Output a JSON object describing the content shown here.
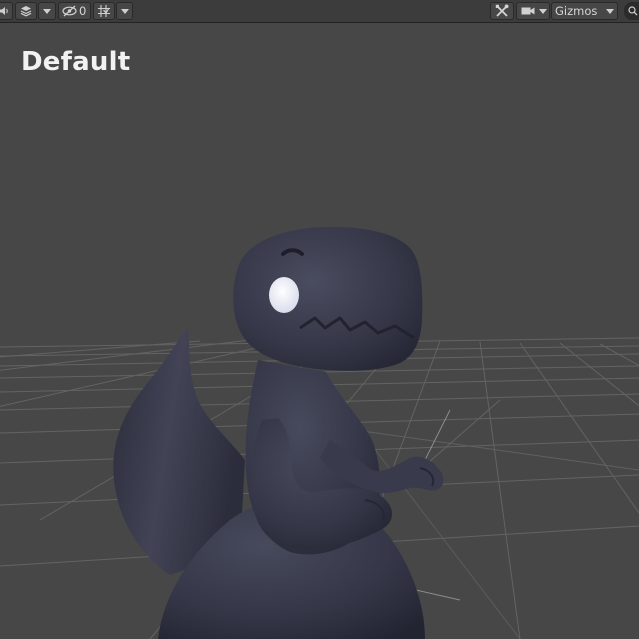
{
  "toolbar": {
    "hidden_count": "0",
    "gizmos_label": "Gizmos",
    "icons": [
      "audio-icon",
      "effects-layers-icon",
      "dropdown-icon",
      "visibility-hidden-icon",
      "grid-snap-icon",
      "dropdown-icon",
      "tools-icon",
      "camera-icon",
      "dropdown-icon",
      "gizmos-dropdown-icon",
      "search-icon"
    ]
  },
  "viewport": {
    "shading_label": "Default",
    "model": "dinosaur-character",
    "colors": {
      "background": "#464746",
      "grid": "#7a7b7a",
      "model": "#343646",
      "text": "#f2f2f2"
    }
  }
}
